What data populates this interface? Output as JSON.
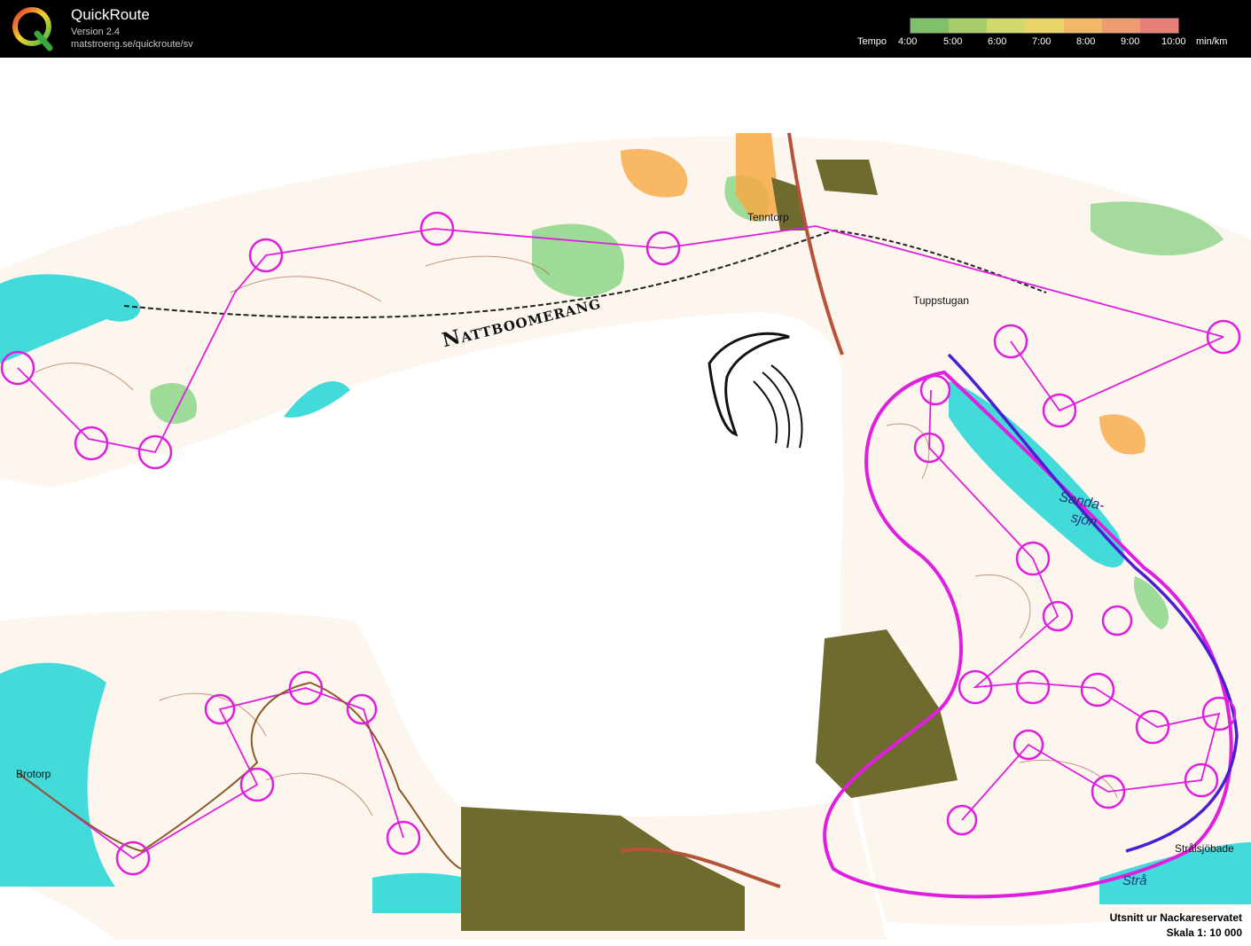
{
  "header": {
    "app_name": "QuickRoute",
    "version": "Version 2.4",
    "url": "matstroeng.se/quickroute/sv",
    "logo_letter": "Q",
    "tempo_label": "Tempo",
    "tempo_ticks": [
      "4:00",
      "5:00",
      "6:00",
      "7:00",
      "8:00",
      "9:00",
      "10:00"
    ],
    "tempo_unit": "min/km",
    "tempo_colors": [
      "#7fc06a",
      "#a9cc6b",
      "#d0d86e",
      "#e9d46a",
      "#f0b868",
      "#ee9c72",
      "#e8807a"
    ]
  },
  "map": {
    "title": "Nattboomerang",
    "labels": {
      "tenntorp": "Tenntorp",
      "tuppstugan": "Tuppstugan",
      "brotorp": "Brotorp",
      "sandasjon_1": "Sanda-",
      "sandasjon_2": "sjön",
      "stralsjobadet": "Strålsjöbade",
      "stra": "Strå"
    },
    "colors": {
      "water": "#43dada",
      "forest_green": "#7ed07b",
      "open_yellow": "#f7a944",
      "settlement": "#6f6a2e",
      "course": "#e01ee0",
      "route": "#4b1fd1",
      "contour": "#a2522a"
    },
    "footer": {
      "source": "Utsnitt ur Nackareservatet",
      "scale": "Skala 1: 10 000"
    }
  }
}
